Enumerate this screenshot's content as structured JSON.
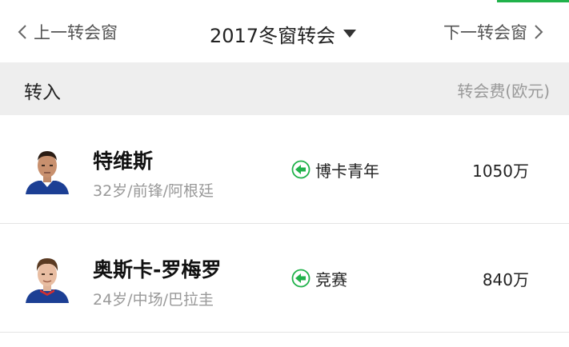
{
  "nav": {
    "prev_label": "上一转会窗",
    "next_label": "下一转会窗",
    "season": "2017冬窗转会",
    "icons": {
      "prev": "chevron-left-icon",
      "next": "chevron-right-icon",
      "dropdown": "caret-down-icon"
    }
  },
  "section": {
    "title": "转入",
    "fee_label": "转会费(欧元)"
  },
  "transfers": [
    {
      "name": "特维斯",
      "meta": "32岁/前锋/阿根廷",
      "from_club": "博卡青年",
      "fee": "1050万",
      "direction_icon": "arrow-left-icon"
    },
    {
      "name": "奥斯卡-罗梅罗",
      "meta": "24岁/中场/巴拉圭",
      "from_club": "竞赛",
      "fee": "840万",
      "direction_icon": "arrow-left-icon"
    }
  ],
  "colors": {
    "accent": "#21b24b",
    "section_bg": "#eeeeee",
    "muted_text": "#999999",
    "jersey": "#1c3f94"
  }
}
